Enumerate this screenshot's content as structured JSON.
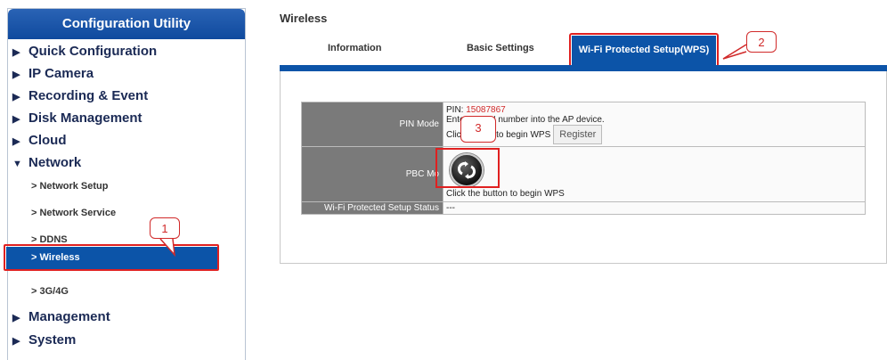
{
  "sidebar": {
    "title": "Configuration Utility",
    "items": [
      {
        "label": "Quick Configuration"
      },
      {
        "label": "IP Camera"
      },
      {
        "label": "Recording & Event"
      },
      {
        "label": "Disk Management"
      },
      {
        "label": "Cloud"
      },
      {
        "label": "Network"
      },
      {
        "label": "Management"
      },
      {
        "label": "System"
      }
    ],
    "network_sub": [
      {
        "label": "> Network Setup"
      },
      {
        "label": "> Network Service"
      },
      {
        "label": "> DDNS"
      },
      {
        "label": "> Wireless"
      },
      {
        "label": "> 3G/4G"
      }
    ]
  },
  "main": {
    "title": "Wireless",
    "tabs": [
      {
        "label": "Information"
      },
      {
        "label": "Basic Settings"
      },
      {
        "label": "Wi-Fi Protected Setup(WPS)"
      }
    ],
    "pin_mode": {
      "label": "PIN Mode",
      "pin_prefix": "PIN: ",
      "pin_value": "15087867",
      "line2": "Ente          N number into the AP device.",
      "line3": "Clic          er to begin WPS",
      "register_label": "Register"
    },
    "pbc_mode": {
      "label": "PBC Mo",
      "hint": "Click the button to begin WPS"
    },
    "status": {
      "label": "Wi-Fi Protected Setup Status",
      "value": "---"
    }
  },
  "callouts": [
    "1",
    "2",
    "3"
  ],
  "colors": {
    "accent": "#0c54a8",
    "annotation": "#e02020",
    "label_bg": "#7a7a7a"
  }
}
